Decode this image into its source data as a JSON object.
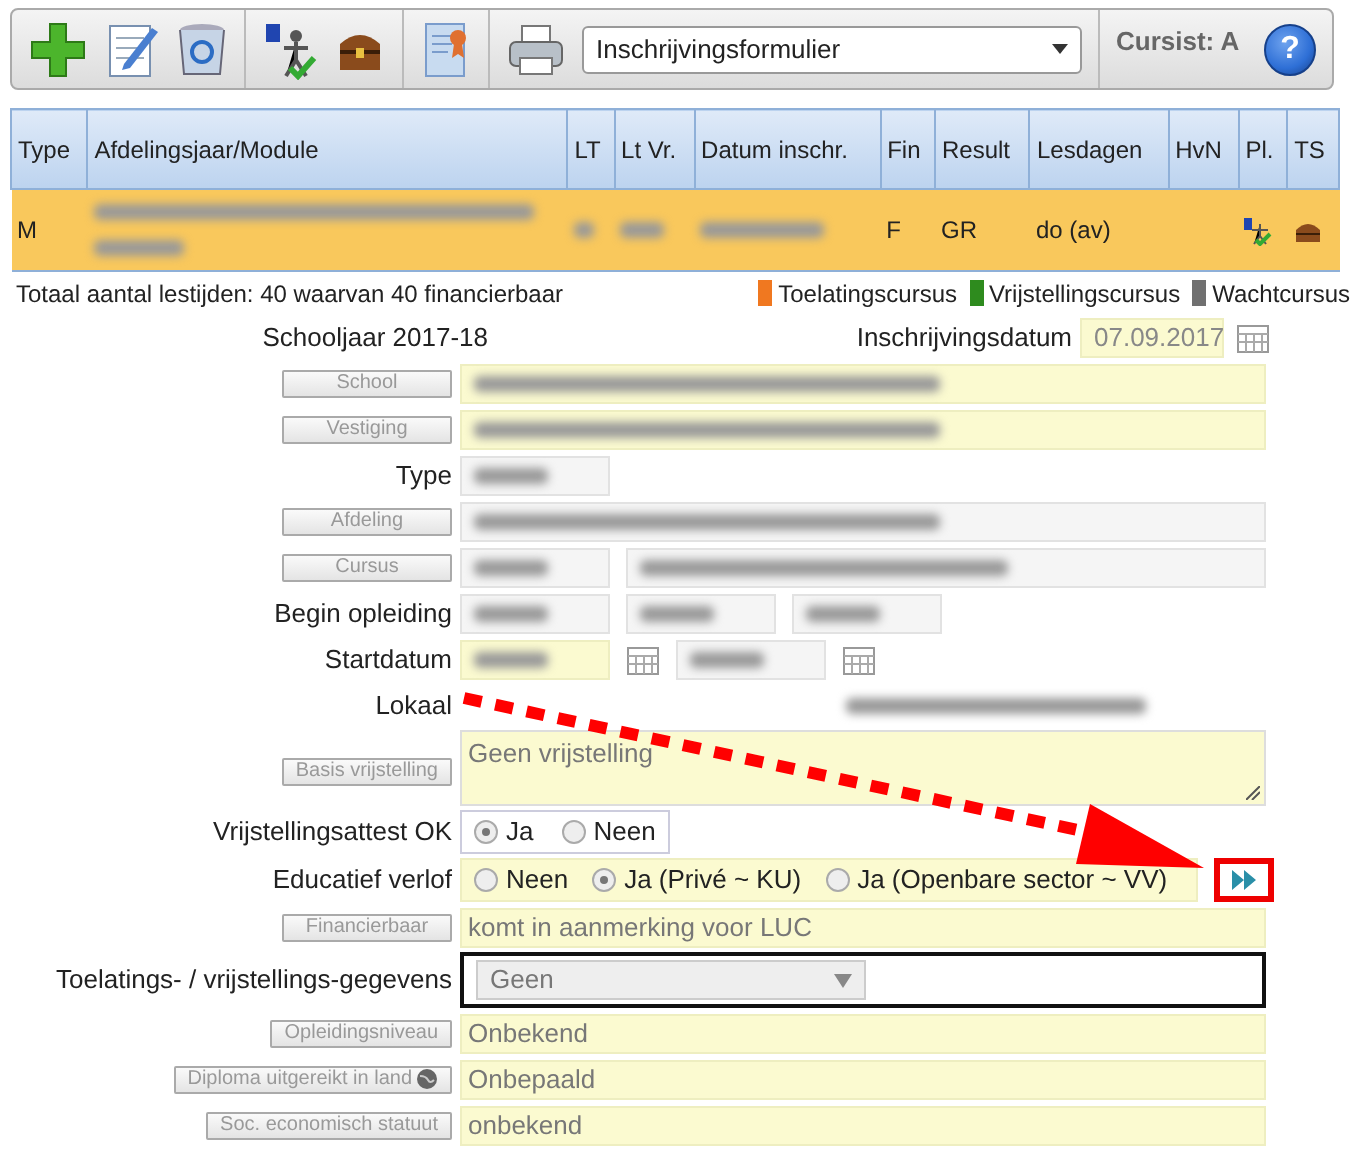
{
  "toolbar": {
    "report_select": {
      "value": "Inschrijvingsformulier"
    },
    "cursist_label": "Cursist: A",
    "help_button": "?"
  },
  "table": {
    "columns": [
      "Type",
      "Afdelingsjaar/Module",
      "LT",
      "Lt Vr.",
      "Datum inschr.",
      "Fin",
      "Result",
      "Lesdagen",
      "HvN",
      "Pl.",
      "TS"
    ],
    "rows": [
      {
        "selected": true,
        "type": "M",
        "fin": "F",
        "result": "GR",
        "lesdagen": "do (av)"
      }
    ]
  },
  "summary": "Totaal aantal lestijden: 40 waarvan 40 financierbaar",
  "legend": [
    {
      "label": "Toelatingscursus",
      "color": "#f07820"
    },
    {
      "label": "Vrijstellingscursus",
      "color": "#2e8b1e"
    },
    {
      "label": "Wachtcursus",
      "color": "#707070"
    }
  ],
  "schooljaar": "Schooljaar 2017-18",
  "inschrijvingsdatum": {
    "label": "Inschrijvingsdatum",
    "value": "07.09.2017"
  },
  "form": [
    {
      "label": "School",
      "button": true,
      "control": {
        "kind": "redacted",
        "parts": [
          {
            "kind": "field",
            "editable": true,
            "wide": true
          }
        ]
      }
    },
    {
      "label": "Vestiging",
      "button": true,
      "control": {
        "kind": "redacted",
        "parts": [
          {
            "kind": "field",
            "editable": true,
            "wide": true
          }
        ]
      }
    },
    {
      "label": "Type",
      "button": false,
      "control": {
        "kind": "redacted",
        "parts": [
          {
            "kind": "field",
            "editable": false,
            "wide": false
          }
        ]
      }
    },
    {
      "label": "Afdeling",
      "button": true,
      "control": {
        "kind": "redacted",
        "parts": [
          {
            "kind": "field",
            "editable": false,
            "wide": true
          }
        ]
      }
    },
    {
      "label": "Cursus",
      "button": true,
      "control": {
        "kind": "redacted",
        "parts": [
          {
            "kind": "field",
            "editable": false,
            "wide": false
          },
          {
            "kind": "field",
            "editable": false,
            "wide": true
          }
        ]
      }
    },
    {
      "label": "Begin opleiding",
      "button": false,
      "control": {
        "kind": "redacted",
        "parts": [
          {
            "kind": "field",
            "editable": false,
            "wide": false
          },
          {
            "kind": "field",
            "editable": false,
            "wide": false
          },
          {
            "kind": "field",
            "editable": false,
            "wide": false
          }
        ]
      }
    },
    {
      "label": "Startdatum",
      "button": false,
      "control": {
        "kind": "redacted",
        "parts": [
          {
            "kind": "field",
            "editable": true,
            "wide": false
          },
          {
            "kind": "calendar"
          },
          {
            "kind": "field",
            "editable": false,
            "wide": false
          },
          {
            "kind": "calendar"
          }
        ]
      }
    },
    {
      "label": "Lokaal",
      "button": false,
      "control": {
        "kind": "redacted",
        "parts": [
          {
            "kind": "spacer"
          },
          {
            "kind": "text"
          }
        ]
      }
    },
    {
      "label": "Basis vrijstelling",
      "button": true,
      "control": {
        "kind": "textarea",
        "value": "Geen vrijstelling"
      }
    },
    {
      "label": "Vrijstellingsattest OK",
      "button": false,
      "control": {
        "kind": "radios",
        "highlight": false,
        "options": [
          {
            "label": "Ja",
            "selected": true
          },
          {
            "label": "Neen",
            "selected": false
          }
        ]
      }
    },
    {
      "label": "Educatief verlof",
      "button": false,
      "control": {
        "kind": "radios",
        "highlight": true,
        "next_button": true,
        "options": [
          {
            "label": "Neen",
            "selected": false
          },
          {
            "label": "Ja (Privé ~ KU)",
            "selected": true
          },
          {
            "label": "Ja (Openbare sector ~ VV)",
            "selected": false
          }
        ]
      }
    },
    {
      "label": "Financierbaar",
      "button": true,
      "control": {
        "kind": "text",
        "value": "komt in aanmerking voor LUC"
      }
    },
    {
      "label": "Toelatings- / vrijstellings-gegevens",
      "button": false,
      "control": {
        "kind": "select",
        "value": "Geen"
      }
    },
    {
      "label": "Opleidingsniveau",
      "button": true,
      "control": {
        "kind": "text",
        "value": "Onbekend"
      }
    },
    {
      "label": "Diploma uitgereikt in land",
      "button": true,
      "globe": true,
      "control": {
        "kind": "text",
        "value": "Onbepaald"
      }
    },
    {
      "label": "Soc. economisch statuut",
      "button": true,
      "control": {
        "kind": "text",
        "value": "onbekend"
      }
    }
  ]
}
